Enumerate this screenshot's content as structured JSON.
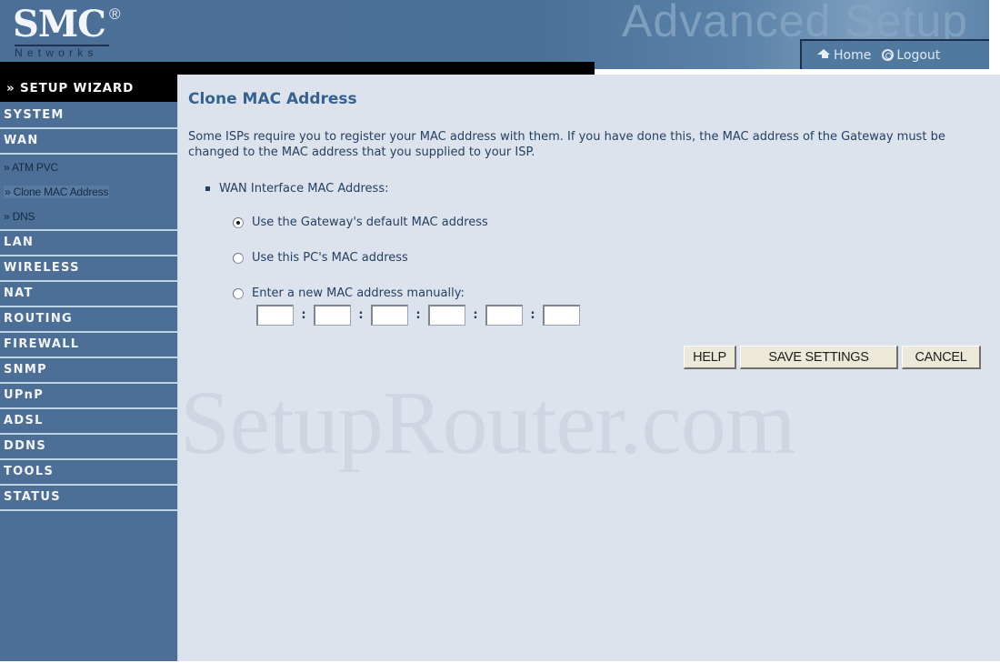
{
  "header": {
    "logo_brand": "SMC",
    "logo_registered": "®",
    "logo_subtitle": "Networks",
    "banner_text": "Advanced Setup",
    "nav": {
      "home_label": "Home",
      "home_icon": "home-icon",
      "logout_label": "Logout",
      "logout_icon": "logout-icon"
    }
  },
  "sidebar": {
    "wizard_label": "» SETUP WIZARD",
    "items": [
      {
        "label": "SYSTEM"
      },
      {
        "label": "WAN",
        "children": [
          {
            "label": "» ATM PVC",
            "active": false
          },
          {
            "label": "» Clone MAC Address",
            "active": true
          },
          {
            "label": "» DNS",
            "active": false
          }
        ]
      },
      {
        "label": "LAN"
      },
      {
        "label": "WIRELESS"
      },
      {
        "label": "NAT"
      },
      {
        "label": "ROUTING"
      },
      {
        "label": "FIREWALL"
      },
      {
        "label": "SNMP"
      },
      {
        "label": "UPnP"
      },
      {
        "label": "ADSL"
      },
      {
        "label": "DDNS"
      },
      {
        "label": "TOOLS"
      },
      {
        "label": "STATUS"
      }
    ]
  },
  "main": {
    "title": "Clone MAC Address",
    "intro": "Some ISPs require you to register your MAC address with them. If you have done this, the MAC address of the Gateway must be changed to the MAC address that you supplied to your ISP.",
    "section_label": "WAN Interface MAC Address:",
    "options": [
      {
        "label": "Use the Gateway's default MAC address",
        "checked": true
      },
      {
        "label": "Use this PC's MAC address",
        "checked": false
      },
      {
        "label": "Enter a new MAC address manually:",
        "checked": false
      }
    ],
    "mac_fields": [
      "",
      "",
      "",
      "",
      "",
      ""
    ],
    "mac_separator": ":",
    "buttons": {
      "help": "HELP",
      "save": "SAVE SETTINGS",
      "cancel": "CANCEL"
    },
    "watermark": "SetupRouter.com"
  },
  "colors": {
    "header_blue": "#4c6f97",
    "sidebar_blue": "#4d6f97",
    "content_bg": "#dde3ed",
    "title_blue": "#35628f",
    "text_navy": "#233f63",
    "button_face": "#ece9d8"
  }
}
